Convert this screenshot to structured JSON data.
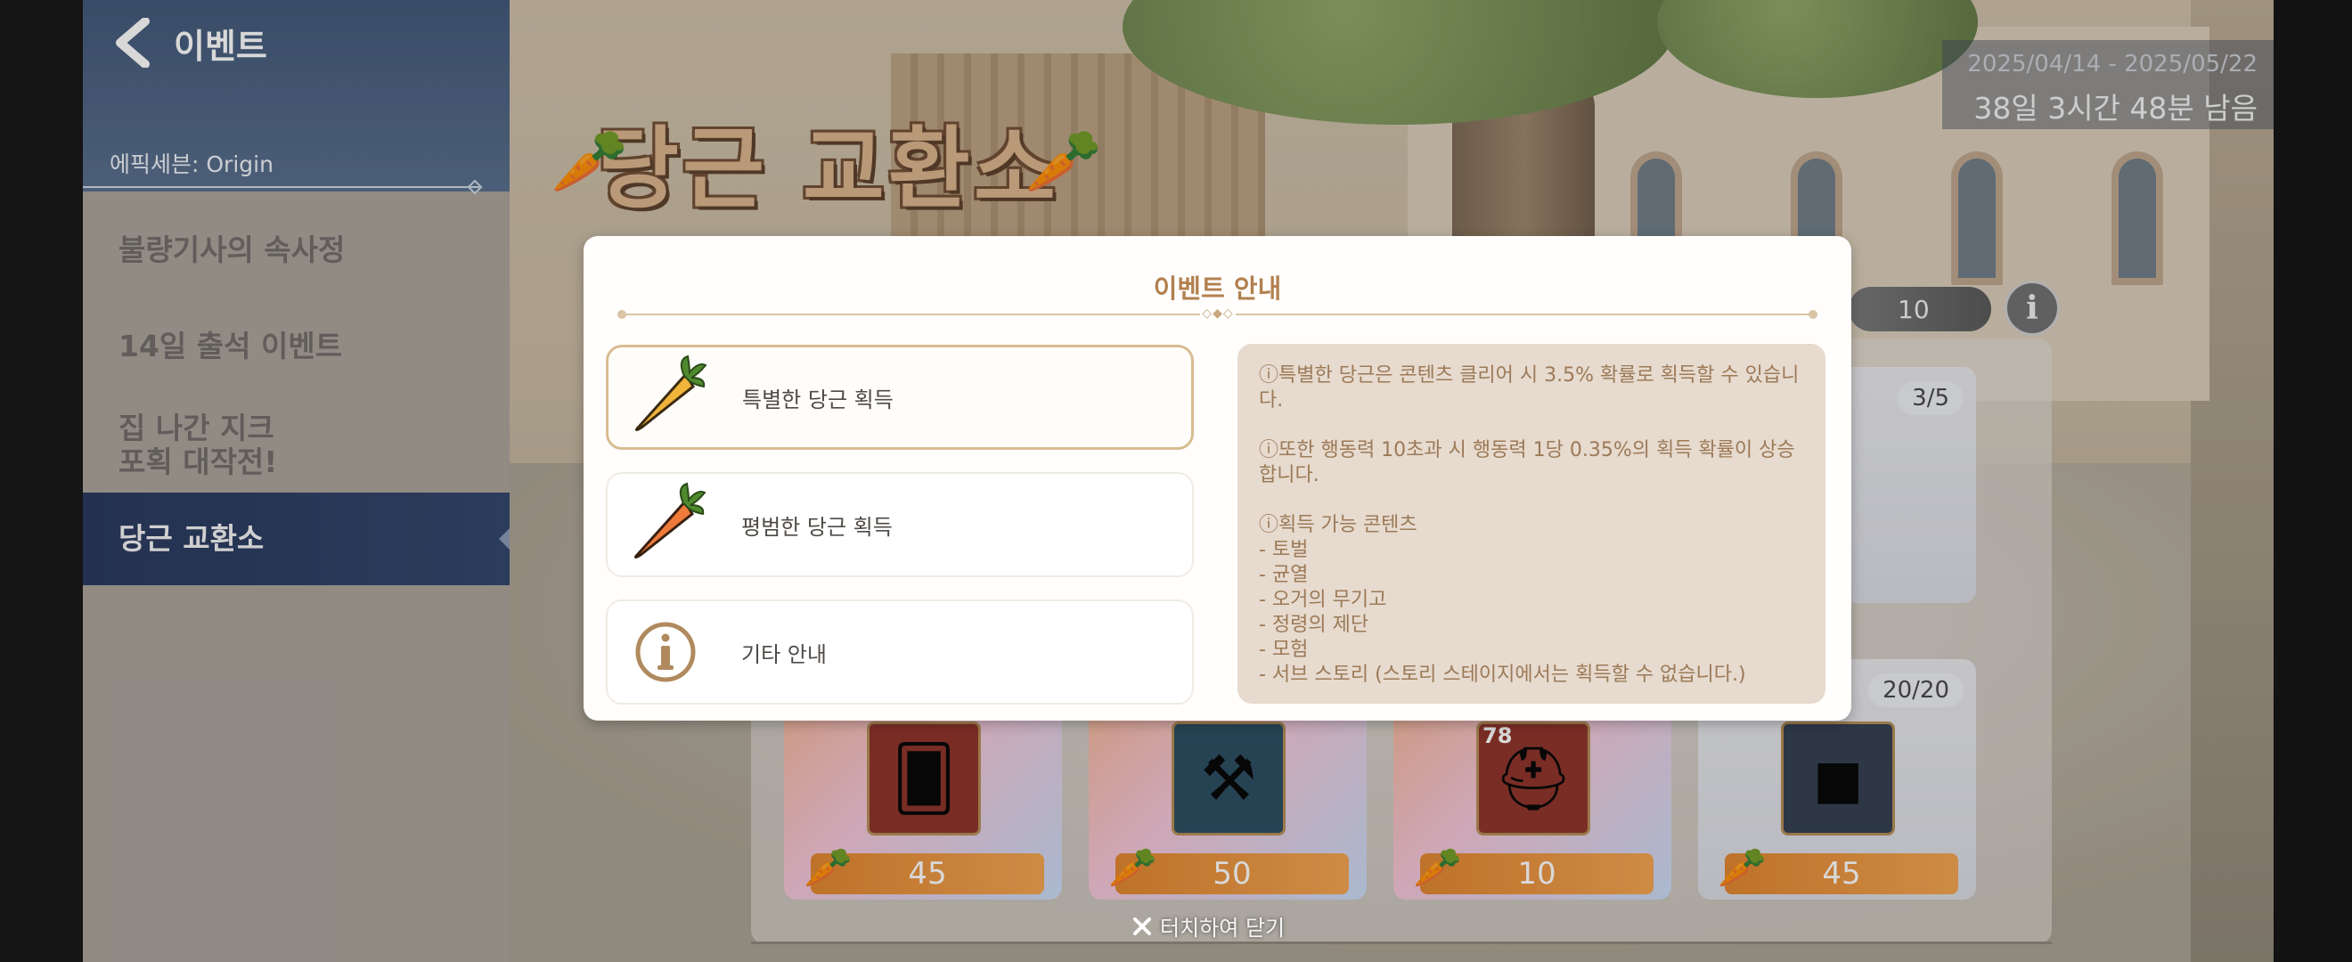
{
  "sidebar": {
    "back_label": "이벤트",
    "subtitle": "에픽세븐: Origin",
    "items": [
      {
        "label": "불량기사의 속사정"
      },
      {
        "label": "14일 출석 이벤트"
      },
      {
        "label": "집 나간 지크\n포획 대작전!"
      },
      {
        "label": "당근 교환소",
        "active": true
      }
    ]
  },
  "event": {
    "title": "당근 교환소",
    "date_range": "2025/04/14 - 2025/05/22",
    "remaining": "38일 3시간 48분 남음"
  },
  "shop": {
    "currency_count": "10",
    "cards": [
      {
        "price": "45",
        "icon": "card-hand-icon"
      },
      {
        "price": "50",
        "icon": "rune-icon"
      },
      {
        "price": "10",
        "icon": "helmet-icon",
        "level": "78"
      },
      {
        "price": "45",
        "icon": "cube-icon",
        "stock": "20/20"
      },
      {
        "stock": "3/5"
      }
    ]
  },
  "modal": {
    "title": "이벤트 안내",
    "tabs": [
      {
        "label": "특별한 당근 획득",
        "icon": "golden-carrot-icon",
        "selected": true
      },
      {
        "label": "평범한 당근 획득",
        "icon": "carrot-icon",
        "selected": false
      },
      {
        "label": "기타 안내",
        "icon": "info-icon",
        "selected": false
      }
    ],
    "description": {
      "p1": "ⓘ특별한 당근은 콘텐츠 클리어 시 3.5% 확률로 획득할 수 있습니다.",
      "p2": "ⓘ또한 행동력 10초과 시 행동력 1당 0.35%의 획득 확률이 상승합니다.",
      "p3_title": "ⓘ획득 가능 콘텐츠",
      "list": [
        "- 토벌",
        "- 균열",
        "- 오거의 무기고",
        "- 정령의 제단",
        "- 모험",
        "- 서브 스토리 (스토리 스테이지에서는 획득할 수 없습니다.)"
      ]
    }
  },
  "close_hint": "터치하여 닫기",
  "colors": {
    "accent": "#b2804f",
    "sidebar_active": "#24345a",
    "price_orange": "#e0832b"
  }
}
